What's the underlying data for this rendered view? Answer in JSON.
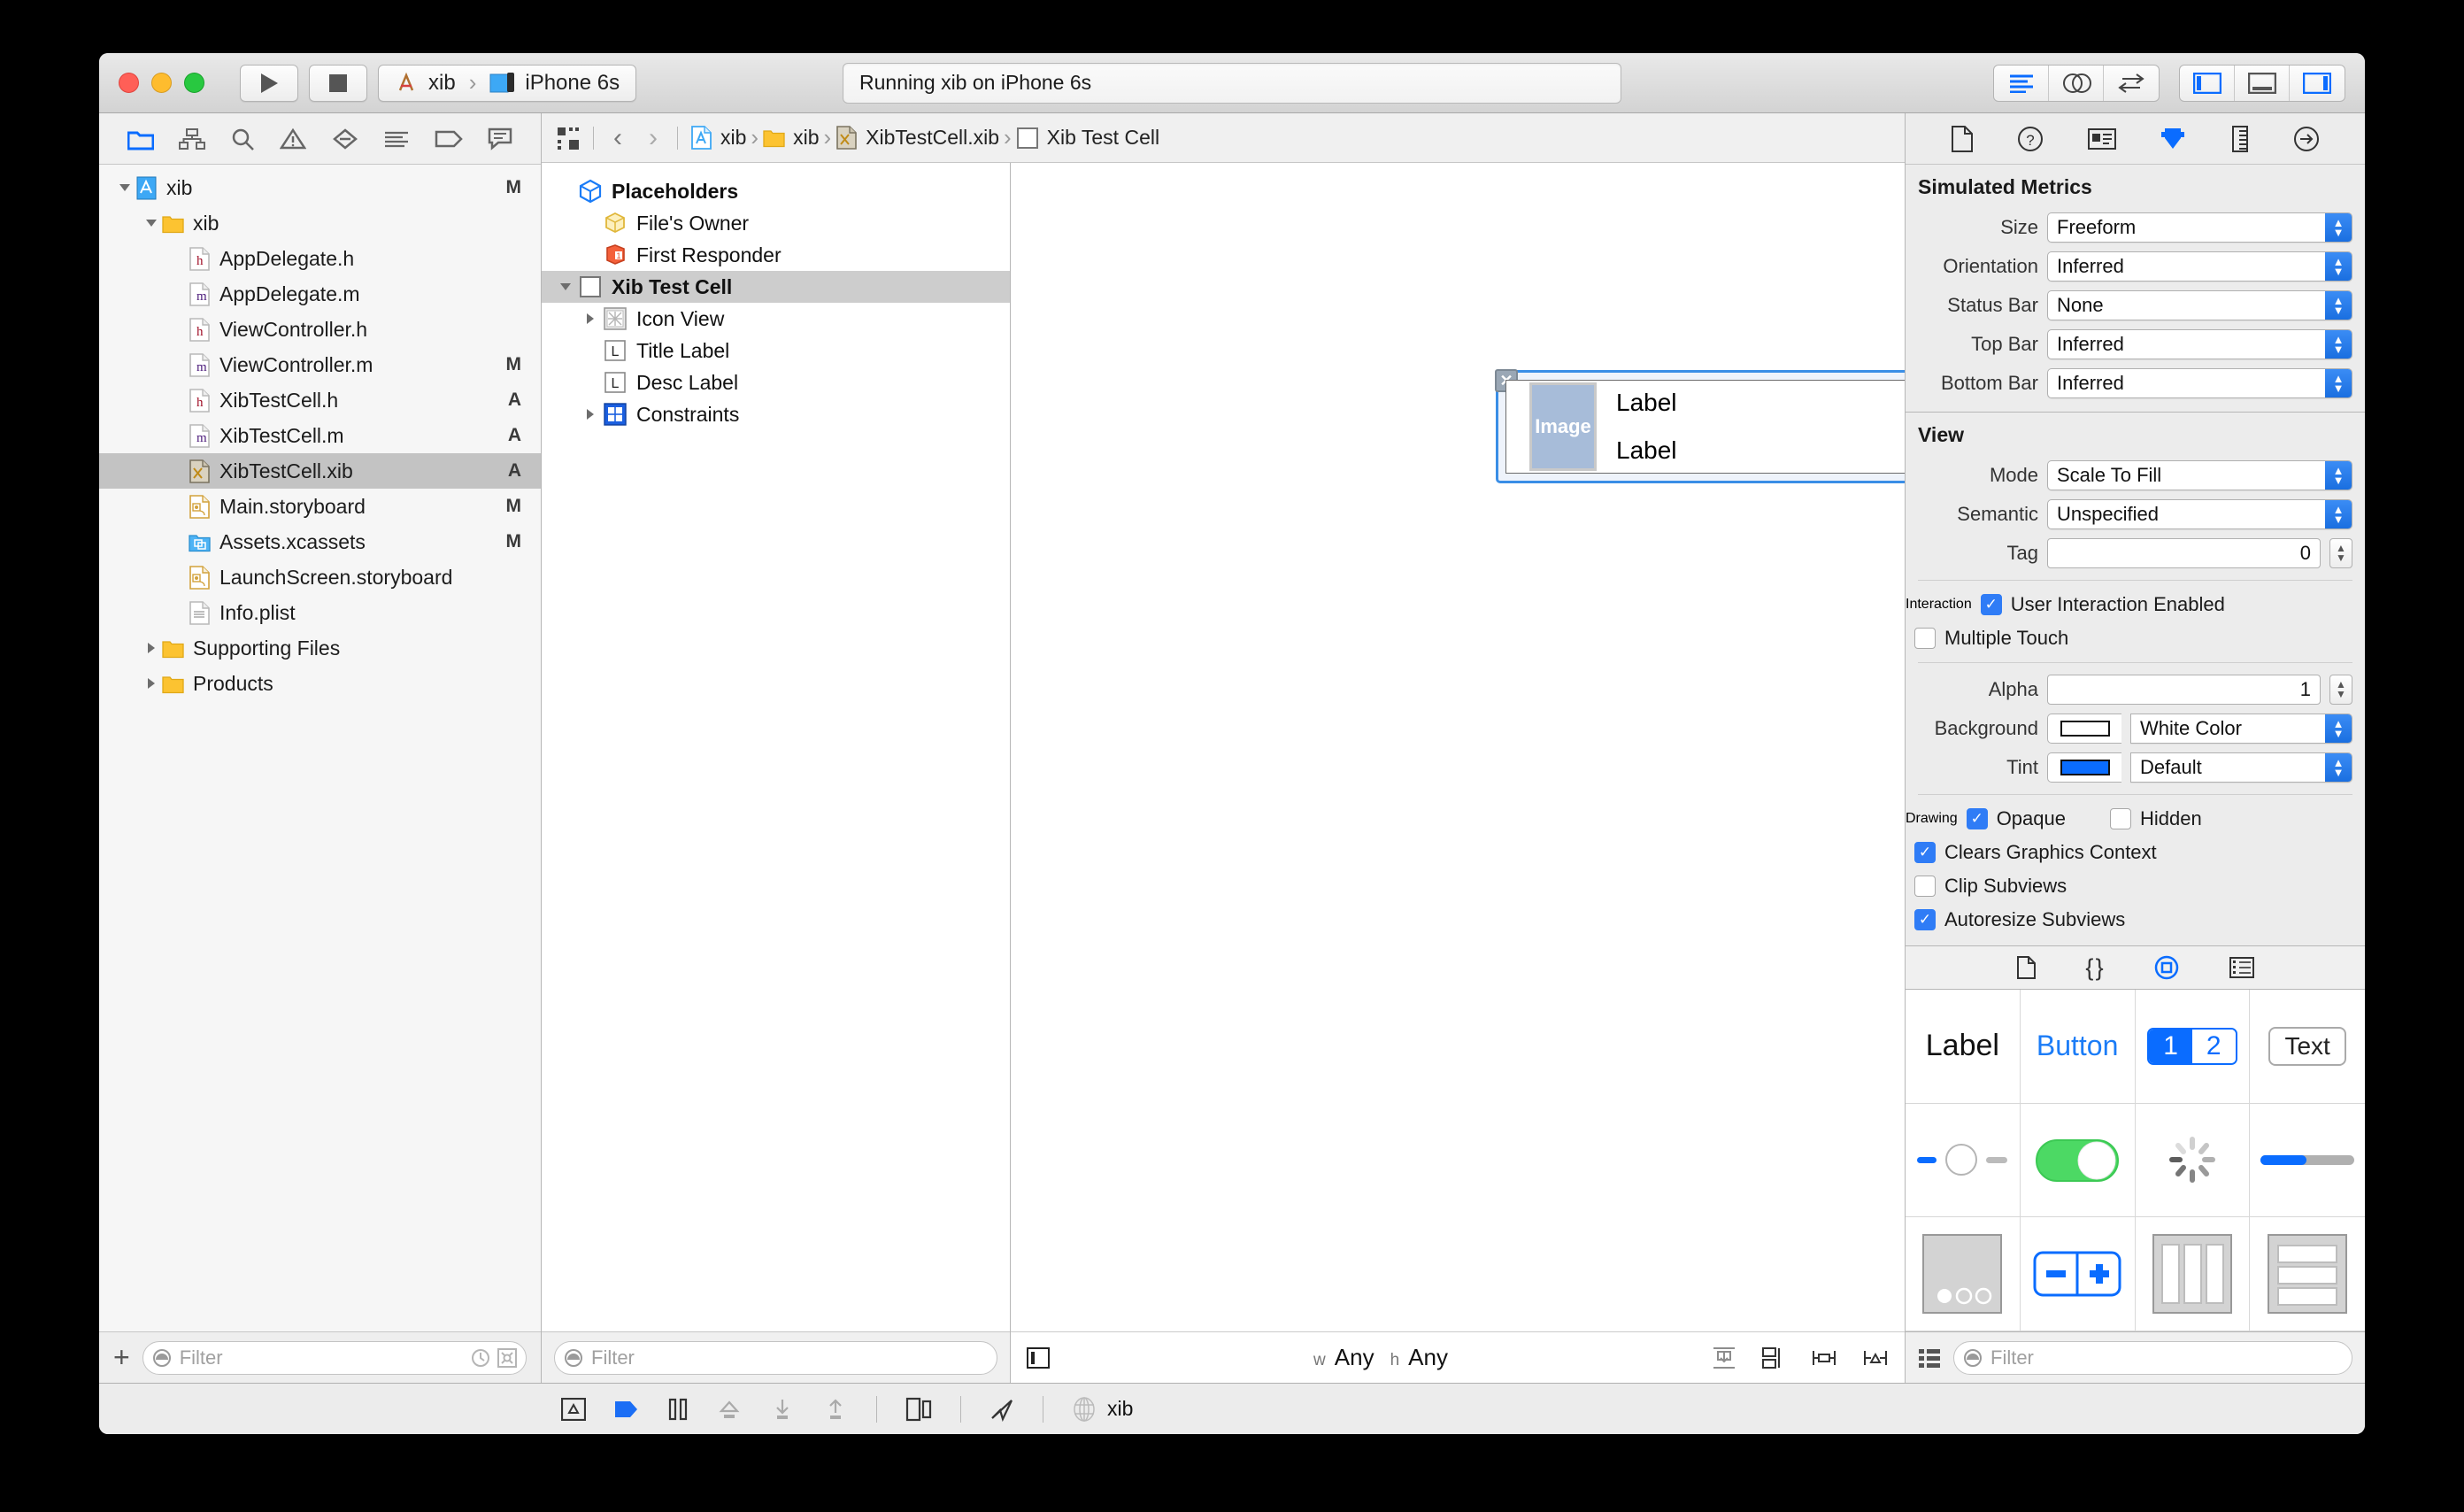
{
  "titlebar": {
    "run_label": "run-button",
    "stop_label": "stop-button",
    "scheme_project": "xib",
    "scheme_device": "iPhone 6s",
    "status": "Running xib on iPhone 6s"
  },
  "navigator": {
    "toolbar_icons": [
      "folder-icon",
      "hierarchy-icon",
      "search-icon",
      "warning-icon",
      "breakpoint-icon",
      "report-icon",
      "tag-icon",
      "comment-icon"
    ],
    "items": [
      {
        "label": "xib",
        "status": "M",
        "depth": 0,
        "icon": "project-icon",
        "twisty": "down"
      },
      {
        "label": "xib",
        "status": "",
        "depth": 1,
        "icon": "folder-icon",
        "twisty": "down"
      },
      {
        "label": "AppDelegate.h",
        "status": "",
        "depth": 2,
        "icon": "h-file-icon",
        "twisty": ""
      },
      {
        "label": "AppDelegate.m",
        "status": "",
        "depth": 2,
        "icon": "m-file-icon",
        "twisty": ""
      },
      {
        "label": "ViewController.h",
        "status": "",
        "depth": 2,
        "icon": "h-file-icon",
        "twisty": ""
      },
      {
        "label": "ViewController.m",
        "status": "M",
        "depth": 2,
        "icon": "m-file-icon",
        "twisty": ""
      },
      {
        "label": "XibTestCell.h",
        "status": "A",
        "depth": 2,
        "icon": "h-file-icon",
        "twisty": ""
      },
      {
        "label": "XibTestCell.m",
        "status": "A",
        "depth": 2,
        "icon": "m-file-icon",
        "twisty": ""
      },
      {
        "label": "XibTestCell.xib",
        "status": "A",
        "depth": 2,
        "icon": "xib-file-icon",
        "twisty": "",
        "selected": true
      },
      {
        "label": "Main.storyboard",
        "status": "M",
        "depth": 2,
        "icon": "storyboard-icon",
        "twisty": ""
      },
      {
        "label": "Assets.xcassets",
        "status": "M",
        "depth": 2,
        "icon": "assets-icon",
        "twisty": ""
      },
      {
        "label": "LaunchScreen.storyboard",
        "status": "",
        "depth": 2,
        "icon": "storyboard-icon",
        "twisty": ""
      },
      {
        "label": "Info.plist",
        "status": "",
        "depth": 2,
        "icon": "plist-icon",
        "twisty": ""
      },
      {
        "label": "Supporting Files",
        "status": "",
        "depth": 1,
        "icon": "folder-icon",
        "twisty": "right"
      },
      {
        "label": "Products",
        "status": "",
        "depth": 1,
        "icon": "folder-icon",
        "twisty": "right"
      }
    ],
    "add_button": "+",
    "filter_placeholder": "Filter"
  },
  "jumpbar": {
    "crumbs": [
      "xib",
      "xib",
      "XibTestCell.xib",
      "Xib Test Cell"
    ]
  },
  "outline": {
    "rows": [
      {
        "label": "Placeholders",
        "icon": "placeholders-icon",
        "depth": 0,
        "bold": true,
        "twisty": ""
      },
      {
        "label": "File's Owner",
        "icon": "files-owner-icon",
        "depth": 1,
        "bold": false,
        "twisty": ""
      },
      {
        "label": "First Responder",
        "icon": "first-responder-icon",
        "depth": 1,
        "bold": false,
        "twisty": ""
      },
      {
        "label": "Xib Test Cell",
        "icon": "view-icon",
        "depth": 0,
        "bold": true,
        "twisty": "down",
        "selected": true
      },
      {
        "label": "Icon View",
        "icon": "imageview-icon",
        "depth": 1,
        "bold": false,
        "twisty": "right"
      },
      {
        "label": "Title Label",
        "icon": "label-icon",
        "depth": 1,
        "bold": false,
        "twisty": ""
      },
      {
        "label": "Desc Label",
        "icon": "label-icon",
        "depth": 1,
        "bold": false,
        "twisty": ""
      },
      {
        "label": "Constraints",
        "icon": "constraints-icon",
        "depth": 1,
        "bold": false,
        "twisty": "right"
      }
    ],
    "filter_placeholder": "Filter"
  },
  "canvas": {
    "cell": {
      "image_placeholder": "Image",
      "title_label": "Label",
      "desc_label": "Label"
    },
    "size_class_w": "w",
    "size_class_w_value": "Any",
    "size_class_h": "h",
    "size_class_h_value": "Any",
    "align_icons": [
      "update-frames-icon",
      "embed-icon",
      "align-icon",
      "pin-icon"
    ]
  },
  "inspector": {
    "tabs": [
      "file-inspector-icon",
      "quick-help-icon",
      "identity-inspector-icon",
      "attributes-inspector-icon",
      "size-inspector-icon",
      "connections-inspector-icon"
    ],
    "active_tab": "attributes-inspector-icon",
    "simulated_metrics": {
      "title": "Simulated Metrics",
      "fields": [
        {
          "label": "Size",
          "value": "Freeform"
        },
        {
          "label": "Orientation",
          "value": "Inferred"
        },
        {
          "label": "Status Bar",
          "value": "None"
        },
        {
          "label": "Top Bar",
          "value": "Inferred"
        },
        {
          "label": "Bottom Bar",
          "value": "Inferred"
        }
      ]
    },
    "view": {
      "title": "View",
      "mode_label": "Mode",
      "mode_value": "Scale To Fill",
      "semantic_label": "Semantic",
      "semantic_value": "Unspecified",
      "tag_label": "Tag",
      "tag_value": "0",
      "interaction_label": "Interaction",
      "user_interaction_enabled": "User Interaction Enabled",
      "multiple_touch": "Multiple Touch",
      "alpha_label": "Alpha",
      "alpha_value": "1",
      "background_label": "Background",
      "background_value": "White Color",
      "background_color": "#ffffff",
      "tint_label": "Tint",
      "tint_value": "Default",
      "tint_color": "#0a6cff",
      "drawing_label": "Drawing",
      "opaque": "Opaque",
      "hidden": "Hidden",
      "clears_graphics_context": "Clears Graphics Context",
      "clip_subviews": "Clip Subviews",
      "autoresize_subviews": "Autoresize Subviews"
    },
    "library": {
      "tabs": [
        "file-template-library-icon",
        "code-snippet-library-icon",
        "object-library-icon",
        "media-library-icon"
      ],
      "active_tab": "object-library-icon",
      "items": [
        {
          "name": "label-object",
          "text": "Label"
        },
        {
          "name": "button-object",
          "text": "Button"
        },
        {
          "name": "segmented-control-object",
          "text": "1 2"
        },
        {
          "name": "text-field-object",
          "text": "Text"
        },
        {
          "name": "slider-object",
          "text": ""
        },
        {
          "name": "switch-object",
          "text": ""
        },
        {
          "name": "activity-indicator-object",
          "text": ""
        },
        {
          "name": "progress-view-object",
          "text": ""
        },
        {
          "name": "page-control-object",
          "text": ""
        },
        {
          "name": "stepper-object",
          "text": ""
        },
        {
          "name": "horizontal-stack-view-object",
          "text": ""
        },
        {
          "name": "table-view-object",
          "text": ""
        }
      ],
      "filter_placeholder": "Filter"
    }
  },
  "debugbar": {
    "icons": [
      "show-debug-area-icon",
      "continue-icon",
      "pause-icon",
      "step-over-icon",
      "step-into-icon",
      "step-out-icon",
      "simulate-location-icon",
      "view-debugging-icon"
    ],
    "process_label": "xib"
  },
  "colors": {
    "accent_blue": "#0a6cff",
    "selection_gray": "#c3c3c3",
    "switch_green": "#4cd964"
  }
}
